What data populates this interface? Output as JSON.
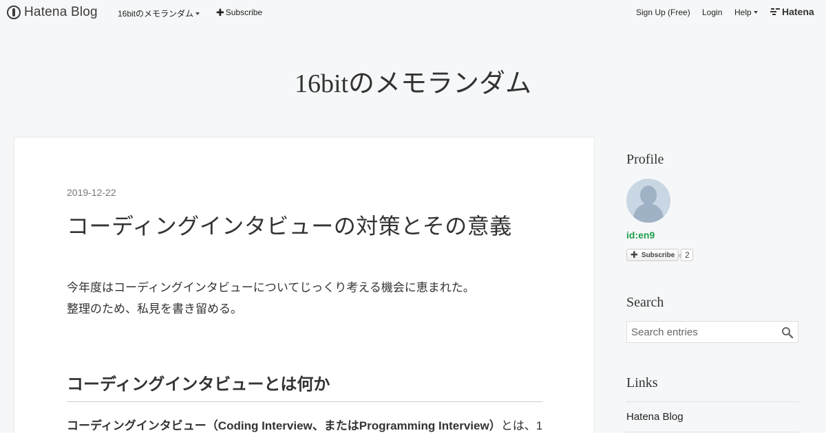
{
  "topbar": {
    "brand": "Hatena Blog",
    "blog_menu": "16bitのメモランダム",
    "subscribe": "Subscribe",
    "signup": "Sign Up (Free)",
    "login": "Login",
    "help": "Help",
    "hatena": "Hatena"
  },
  "blog": {
    "title": "16bitのメモランダム"
  },
  "entry": {
    "date": "2019-12-22",
    "title": "コーディングインタビューの対策とその意義",
    "para1": "今年度はコーディングインタビューについてじっくり考える機会に恵まれた。",
    "para2": "整理のため、私見を書き留める。",
    "section_heading": "コーディングインタビューとは何か",
    "para3_bold": "コーディングインタビュー（Coding Interview、またはProgramming Interview）",
    "para3_rest": "とは、1"
  },
  "sidebar": {
    "profile_heading": "Profile",
    "user_id": "id:en9",
    "subscribe_label": "Subscribe",
    "subscriber_count": "2",
    "search_heading": "Search",
    "search_placeholder": "Search entries",
    "links_heading": "Links",
    "links": [
      "Hatena Blog"
    ]
  },
  "colors": {
    "background": "#f6f7f8",
    "card": "#ffffff",
    "user_id": "#1c9e4a",
    "text": "#333333"
  },
  "icons": [
    "hatena-blog-logo-icon",
    "plus-icon",
    "chevron-down-icon",
    "hatena-logo-icon",
    "avatar-icon",
    "search-icon"
  ]
}
